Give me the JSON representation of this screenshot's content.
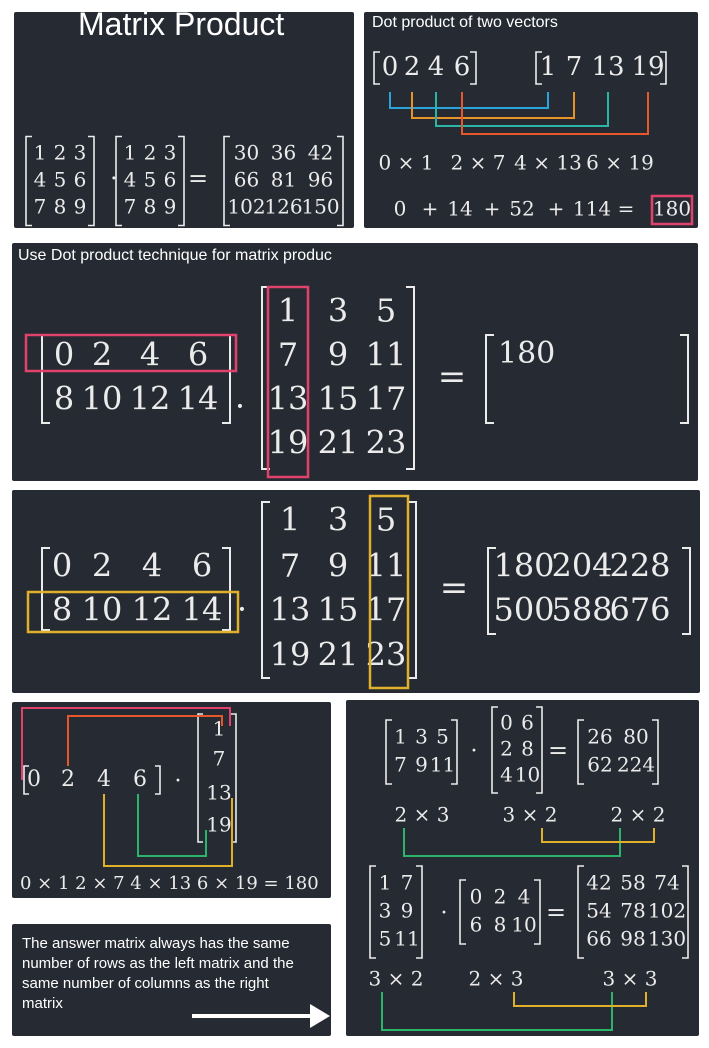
{
  "panel1": {
    "title": "Matrix Product",
    "A": [
      [
        "1",
        "2",
        "3"
      ],
      [
        "4",
        "5",
        "6"
      ],
      [
        "7",
        "8",
        "9"
      ]
    ],
    "B": [
      [
        "1",
        "2",
        "3"
      ],
      [
        "4",
        "5",
        "6"
      ],
      [
        "7",
        "8",
        "9"
      ]
    ],
    "C": [
      [
        "30",
        "36",
        "42"
      ],
      [
        "66",
        "81",
        "96"
      ],
      [
        "102",
        "126",
        "150"
      ]
    ],
    "dot": "·",
    "eq": "="
  },
  "panel2": {
    "title": "Dot product of two vectors",
    "v1": [
      "0",
      "2",
      "4",
      "6"
    ],
    "v2": [
      "1",
      "7",
      "13",
      "19"
    ],
    "products": [
      "0 × 1",
      "2 × 7",
      "4 × 13",
      "6 × 19"
    ],
    "sum": [
      "0",
      "+",
      "14",
      "+",
      "52",
      "+",
      "114",
      "="
    ],
    "result": "180",
    "colors": [
      "#2aa3d8",
      "#e8922a",
      "#2bb5a6",
      "#e8572a"
    ],
    "highlight": "#e0426c"
  },
  "panel3": {
    "title": "Use Dot product technique for matrix produc",
    "A": [
      [
        "0",
        "2",
        "4",
        "6"
      ],
      [
        "8",
        "10",
        "12",
        "14"
      ]
    ],
    "B": [
      [
        "1",
        "3",
        "5"
      ],
      [
        "7",
        "9",
        "11"
      ],
      [
        "13",
        "15",
        "17"
      ],
      [
        "19",
        "21",
        "23"
      ]
    ],
    "result": "180",
    "dot": ".",
    "eq": "=",
    "highlight": "#e0426c"
  },
  "panel4": {
    "A": [
      [
        "0",
        "2",
        "4",
        "6"
      ],
      [
        "8",
        "10",
        "12",
        "14"
      ]
    ],
    "B": [
      [
        "1",
        "3",
        "5"
      ],
      [
        "7",
        "9",
        "11"
      ],
      [
        "13",
        "15",
        "17"
      ],
      [
        "19",
        "21",
        "23"
      ]
    ],
    "C": [
      [
        "180",
        "204",
        "228"
      ],
      [
        "500",
        "588",
        "676"
      ]
    ],
    "dot": ".",
    "eq": "=",
    "highlight": "#e0b02a"
  },
  "panel5": {
    "row": [
      "0",
      "2",
      "4",
      "6"
    ],
    "col": [
      "1",
      "7",
      "13",
      "19"
    ],
    "dot": "·",
    "equation": "0 × 1   2 × 7   4 × 13   6 × 19  = 180",
    "colors": [
      "#e0426c",
      "#e8572a",
      "#e0b02a",
      "#2bb56a"
    ]
  },
  "panel6": {
    "A1": [
      [
        "1",
        "3",
        "5"
      ],
      [
        "7",
        "9",
        "11"
      ]
    ],
    "B1": [
      [
        "0",
        "6"
      ],
      [
        "2",
        "8"
      ],
      [
        "4",
        "10"
      ]
    ],
    "C1": [
      [
        "26",
        "80"
      ],
      [
        "62",
        "224"
      ]
    ],
    "dims1": [
      "2 × 3",
      "3 × 2",
      "2 × 2"
    ],
    "A2": [
      [
        "1",
        "7"
      ],
      [
        "3",
        "9"
      ],
      [
        "5",
        "11"
      ]
    ],
    "B2": [
      [
        "0",
        "2",
        "4"
      ],
      [
        "6",
        "8",
        "10"
      ]
    ],
    "C2": [
      [
        "42",
        "58",
        "74"
      ],
      [
        "54",
        "78",
        "102"
      ],
      [
        "66",
        "98",
        "130"
      ]
    ],
    "dims2": [
      "3 × 2",
      "2 × 3",
      "3 × 3"
    ],
    "dot": "·",
    "eq": "=",
    "colors": [
      "#2bb56a",
      "#e0b02a"
    ]
  },
  "note": {
    "lines": [
      "The answer matrix always has the same",
      "number of rows as the left matrix and the",
      "same number of columns as the right",
      "matrix"
    ]
  }
}
